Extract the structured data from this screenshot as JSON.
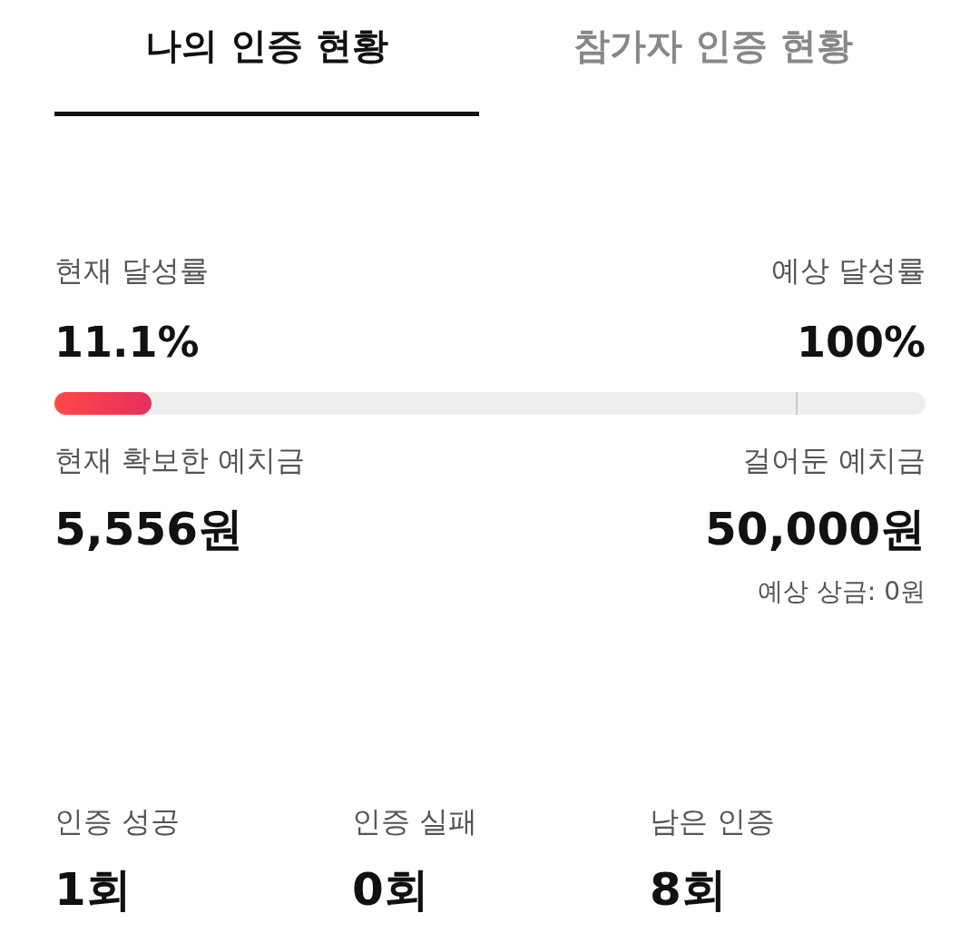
{
  "tabs": [
    {
      "label": "나의 인증 현황",
      "selected": true
    },
    {
      "label": "참가자 인증 현황",
      "selected": false
    }
  ],
  "achievement": {
    "current": {
      "label": "현재 달성률",
      "value": "11.1%"
    },
    "expected": {
      "label": "예상 달성률",
      "value": "100%"
    }
  },
  "progress": {
    "level": 0.111,
    "marker": {
      "level": 0.851
    }
  },
  "deposit": {
    "secured": {
      "label": "현재 확보한 예치금",
      "value": "5,556원"
    },
    "staked": {
      "label": "걸어둔 예치금",
      "value": "50,000원"
    },
    "expected_prize": "예상 상금: 0원"
  },
  "stats": [
    {
      "label": "인증 성공",
      "value": "1회"
    },
    {
      "label": "인증 실패",
      "value": "0회"
    },
    {
      "label": "남은 인증",
      "value": "8회"
    }
  ]
}
